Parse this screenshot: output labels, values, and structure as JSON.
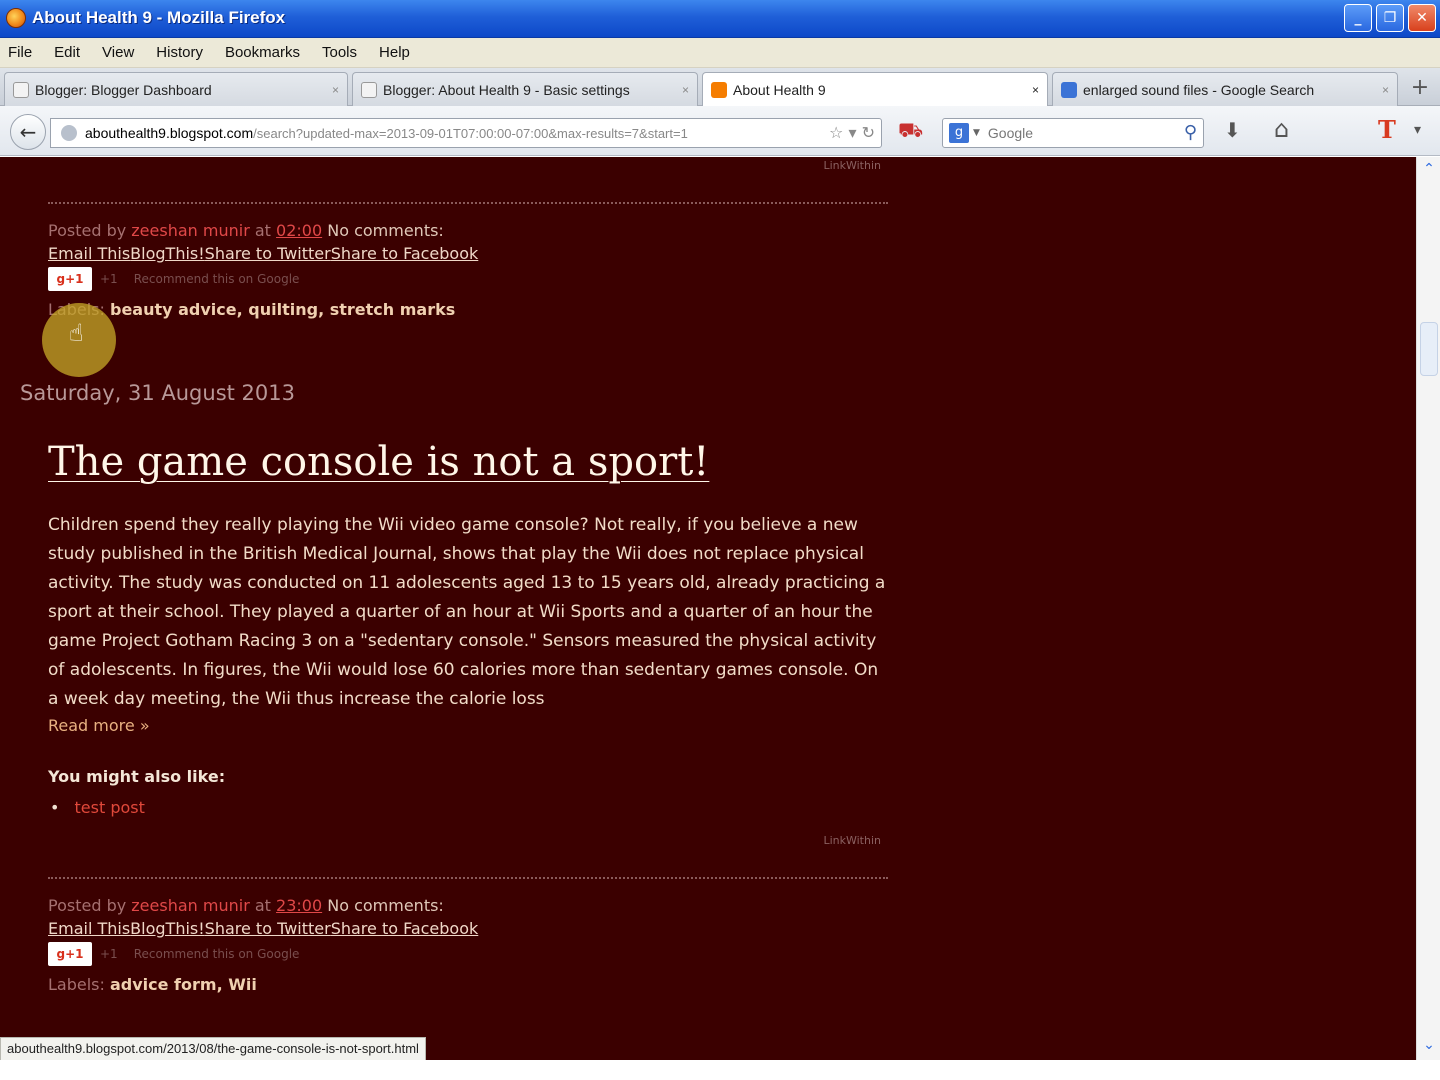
{
  "window": {
    "title": "About Health 9 - Mozilla Firefox",
    "minimize_glyph": "_",
    "maximize_glyph": "❐",
    "close_glyph": "✕"
  },
  "menu": [
    "File",
    "Edit",
    "View",
    "History",
    "Bookmarks",
    "Tools",
    "Help"
  ],
  "tabs": [
    {
      "label": "Blogger: Blogger Dashboard",
      "close": "×",
      "active": false,
      "icon": "blank-page-icon"
    },
    {
      "label": "Blogger: About Health 9 - Basic settings",
      "close": "×",
      "active": false,
      "icon": "blank-page-icon"
    },
    {
      "label": "About Health 9",
      "close": "×",
      "active": true,
      "icon": "blogger-icon"
    },
    {
      "label": "enlarged sound files - Google Search",
      "close": "×",
      "active": false,
      "icon": "google-icon"
    }
  ],
  "new_tab_glyph": "+",
  "nav": {
    "back_glyph": "←",
    "url_domain": "abouthealth9.blogspot.com",
    "url_path": "/search?updated-max=2013-09-01T07:00:00-07:00&max-results=7&start=1",
    "url_icons": "☆ ▾ ↻",
    "search_engine": "g",
    "search_caret": "▼",
    "search_placeholder": "Google",
    "search_go": "⚲",
    "glyph_addon": "⛟",
    "glyph_download": "⬇",
    "glyph_home": "⌂",
    "glyph_t": "T",
    "glyph_menu": "▾"
  },
  "page": {
    "background": "#3b0000",
    "linkwithin": "LinkWithin",
    "post1": {
      "posted_by": "Posted by",
      "author": "zeeshan munir",
      "at": "at",
      "time": "02:00",
      "comments": "No comments:",
      "share": [
        "Email This",
        "BlogThis!",
        "Share to Twitter",
        "Share to Facebook"
      ],
      "plusone": "g+1",
      "plusone_count": "+1",
      "recommend": "Recommend this on Google",
      "labels_prefix": "Labels:",
      "labels": "beauty advice, quilting, stretch marks"
    },
    "date_header": "Saturday, 31 August 2013",
    "post2": {
      "title": "The game console is not a sport!",
      "body": "Children spend they really playing the Wii video game console? Not really, if you believe a new study published in the British Medical Journal, shows that play the Wii does not replace physical activity. The study was conducted on 11 adolescents aged 13 to 15 years old, already practicing a sport at their school. They played a quarter of an hour at Wii Sports and a quarter of an hour the game Project Gotham Racing 3 on a \"sedentary console.\" Sensors measured the physical activity of adolescents. In figures, the Wii would lose 60 calories more than sedentary games console. On a week day meeting, the Wii thus increase the calorie loss",
      "read_more": "Read more »",
      "also_like_heading": "You might also like:",
      "also_like_item": "test post",
      "bullet": "•",
      "posted_by": "Posted by",
      "author": "zeeshan munir",
      "at": "at",
      "time": "23:00",
      "comments": "No comments:",
      "share": [
        "Email This",
        "BlogThis!",
        "Share to Twitter",
        "Share to Facebook"
      ],
      "plusone": "g+1",
      "plusone_count": "+1",
      "recommend": "Recommend this on Google",
      "labels_prefix": "Labels:",
      "labels": "advice form, Wii"
    }
  },
  "cursor_glyph": "☝",
  "scroll": {
    "up": "⌃",
    "down": "⌄"
  },
  "status_url": "abouthealth9.blogspot.com/2013/08/the-game-console-is-not-sport.html"
}
